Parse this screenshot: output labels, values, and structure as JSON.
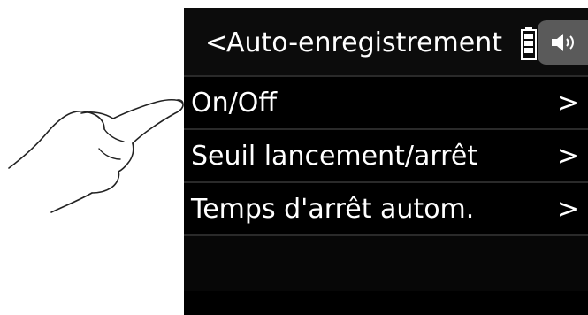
{
  "header": {
    "back_symbol": "<",
    "title": "Auto-enregistrement",
    "battery_icon": "battery-icon",
    "speaker_icon": "speaker-icon"
  },
  "menu": {
    "items": [
      {
        "label": "On/Off",
        "chevron": ">"
      },
      {
        "label": "Seuil lancement/arrêt",
        "chevron": ">"
      },
      {
        "label": "Temps d'arrêt autom.",
        "chevron": ">"
      }
    ]
  },
  "colors": {
    "screen_background": "#000000",
    "text": "#ffffff",
    "divider": "#2a2a2a",
    "speaker_tab": "#5a5a5a"
  }
}
